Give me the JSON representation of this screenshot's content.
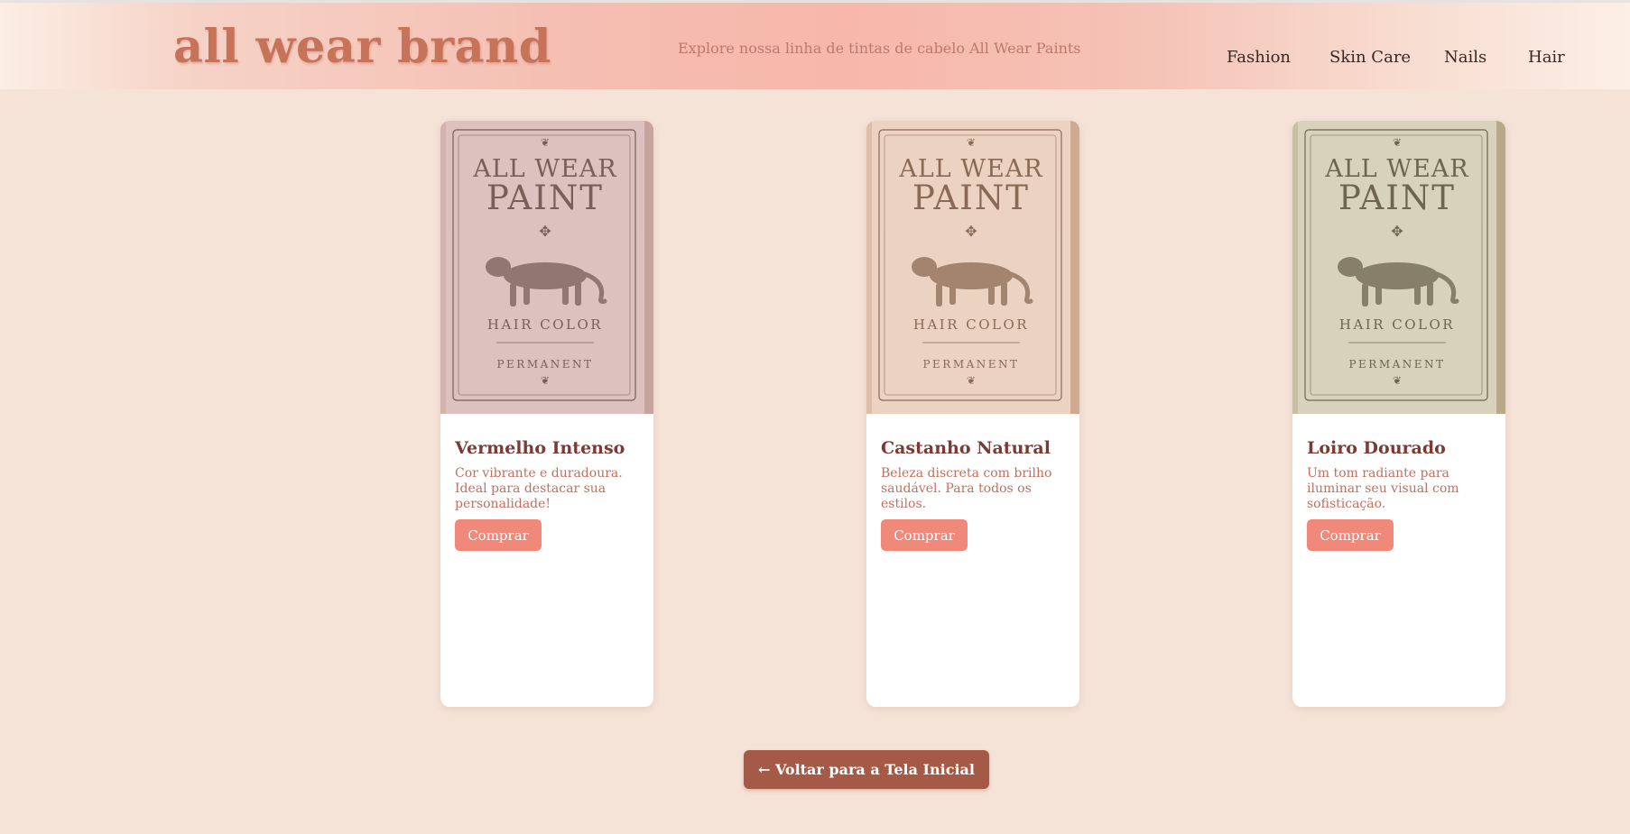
{
  "header": {
    "brand": "all wear brand",
    "tagline": "Explore nossa linha de tintas de cabelo All Wear Paints",
    "nav": [
      "Fashion",
      "Skin Care",
      "Nails",
      "Hair"
    ]
  },
  "package": {
    "brand_line1": "ALL WEAR",
    "brand_line2": "PAINT",
    "product": "HAIR COLOR",
    "type": "PERMANENT"
  },
  "products": [
    {
      "title": "Vermelho Intenso",
      "description": "Cor vibrante e duradoura. Ideal para destacar sua personalidade!",
      "button": "Comprar",
      "box_color": "#dcc1be",
      "ink_color": "#7a5e58",
      "side_color": "#c7a59f"
    },
    {
      "title": "Castanho Natural",
      "description": "Beleza discreta com brilho saudável. Para todos os estilos.",
      "button": "Comprar",
      "box_color": "#ecd2c0",
      "ink_color": "#8a6a55",
      "side_color": "#cfaa90"
    },
    {
      "title": "Loiro Dourado",
      "description": "Um tom radiante para iluminar seu visual com sofisticação.",
      "button": "Comprar",
      "box_color": "#d8d2bc",
      "ink_color": "#6e6450",
      "side_color": "#b7a98a"
    }
  ],
  "back_button": "← Voltar para a Tela Inicial"
}
